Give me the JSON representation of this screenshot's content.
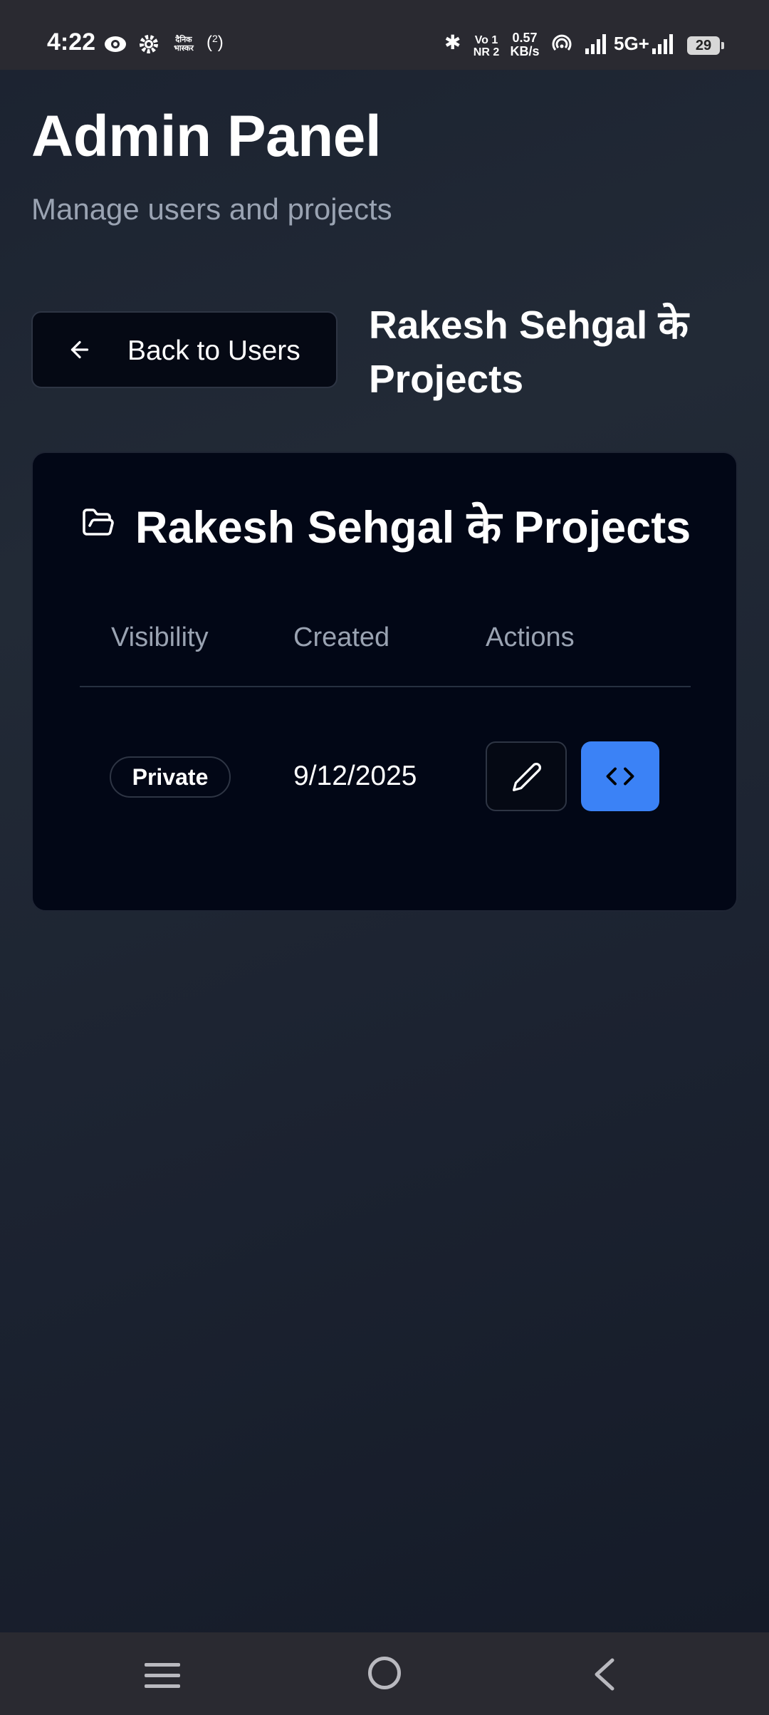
{
  "status_bar": {
    "time": "4:22",
    "left_icons": [
      "eye-icon",
      "gear-icon",
      "news-app-icon",
      "hotspot-icon"
    ],
    "news_app_label": "दैनिक भास्कर",
    "hotspot_label": "2",
    "network_label_top": "Vo 1",
    "network_label_bottom": "NR 2",
    "speed_value": "0.57",
    "speed_unit": "KB/s",
    "network_type": "5G+",
    "battery": "29"
  },
  "header": {
    "title": "Admin Panel",
    "subtitle": "Manage users and projects"
  },
  "back_button": {
    "label": "Back to Users",
    "icon": "arrow-left-icon"
  },
  "section_title": "Rakesh Sehgal के Projects",
  "card": {
    "title": "Rakesh Sehgal के Projects",
    "icon": "folder-open-icon",
    "columns": [
      "Visibility",
      "Created",
      "Actions"
    ],
    "rows": [
      {
        "visibility": "Private",
        "created": "9/12/2025",
        "actions": [
          "pencil-icon",
          "code-icon"
        ]
      }
    ]
  },
  "colors": {
    "accent": "#3b82f6",
    "card_bg": "#020716",
    "muted_text": "#9aa3b2"
  },
  "nav_bar": {
    "icons": [
      "menu-icon",
      "home-icon",
      "back-icon"
    ]
  }
}
